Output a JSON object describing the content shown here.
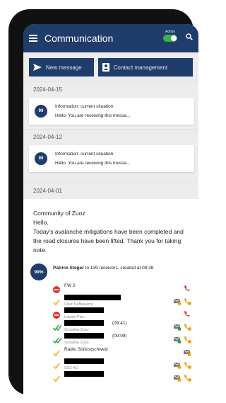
{
  "header": {
    "title": "Communication",
    "toggle_label": "Admin",
    "toggle_on": true
  },
  "actions": {
    "new_message": "New message",
    "contact_management": "Contact management"
  },
  "messages": [
    {
      "date": "2024-04-15",
      "badge": "99",
      "title": "Information: current situation",
      "preview": "Hello. You are receiving this messa..."
    },
    {
      "date": "2024-04-12",
      "badge": "99",
      "title": "Information: current situation",
      "preview": "Hello. You are receiving this messa..."
    }
  ],
  "detail": {
    "date": "2024-04-01",
    "sender": "Community of Zuoz",
    "greeting": "Hello.",
    "body": "Today's avalanche mitigations have been completed and the road closures have been lifted. Thank you for taking note.",
    "progress_label": "99%",
    "author": "Patrick Steger",
    "summary": " to 139 receivers, created at 08:38"
  },
  "receivers": [
    {
      "status": "failed",
      "name": "FW 2",
      "sub": "",
      "stamp": "",
      "redacted": false
    },
    {
      "status": "sent",
      "name": "",
      "sub": "Chef Tiefbauamt",
      "stamp": "",
      "redacted": true
    },
    {
      "status": "failed",
      "name": "",
      "sub": "Loipen Pisv",
      "stamp": "",
      "redacted": true
    },
    {
      "status": "read",
      "name": "",
      "sub": "Scoulina Zuoz",
      "stamp": "(09:41)",
      "redacted": true
    },
    {
      "status": "read",
      "name": "",
      "sub": "Scoulina Zuoz",
      "stamp": "(09:09)",
      "redacted": true
    },
    {
      "status": "sent",
      "name": "Radio Südostschweiz",
      "sub": "",
      "stamp": "",
      "redacted": false
    },
    {
      "status": "sent",
      "name": "",
      "sub": "SSZ AG",
      "stamp": "",
      "redacted": true
    },
    {
      "status": "sent",
      "name": "",
      "sub": "",
      "stamp": "",
      "redacted": true
    }
  ],
  "colors": {
    "primary": "#1f3c6a",
    "failed": "#e03131",
    "sent": "#f59f00",
    "read": "#2f9e44"
  }
}
